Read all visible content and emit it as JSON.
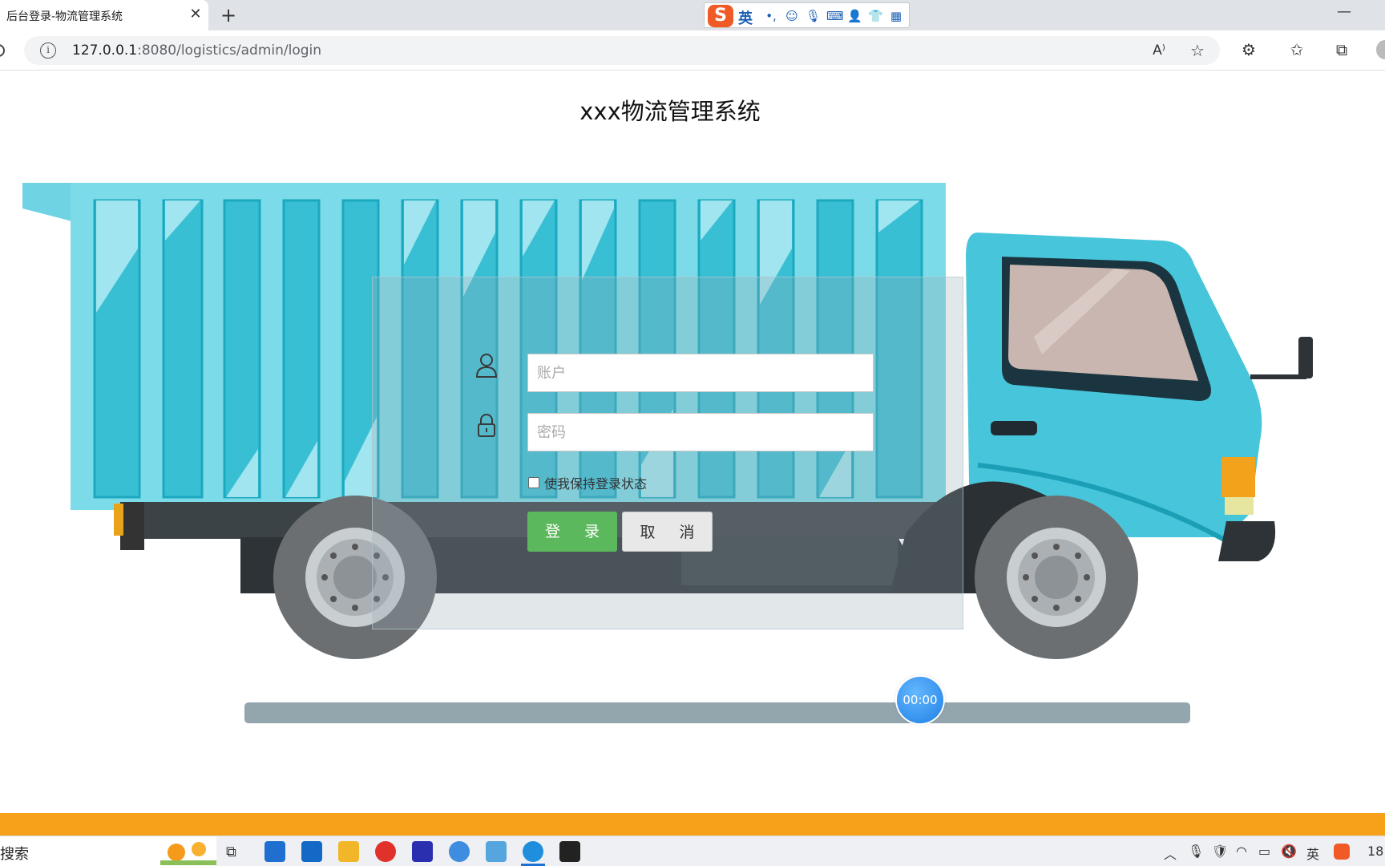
{
  "browser": {
    "tab_title": "后台登录-物流管理系统",
    "tab_close": "✕",
    "new_tab": "+",
    "minimize": "—",
    "url_host": "127.0.0.1",
    "url_path": ":8080/logistics/admin/login"
  },
  "ime": {
    "logo": "S",
    "lang": "英"
  },
  "page": {
    "title": "xxx物流管理系统"
  },
  "login": {
    "username_placeholder": "账户",
    "password_placeholder": "密码",
    "remember_label": "使我保持登录状态",
    "login_button": "登 录",
    "cancel_button": "取 消"
  },
  "overlay": {
    "timer": "00:00"
  },
  "taskbar": {
    "search_text": "搜索",
    "tray_lang": "英",
    "clock_partial": "18"
  },
  "colors": {
    "truck_cyan": "#4fc9dc",
    "login_green": "#5cb85c",
    "bottom_strip": "#f7a11a",
    "timer_blue": "#2b8ef0"
  }
}
